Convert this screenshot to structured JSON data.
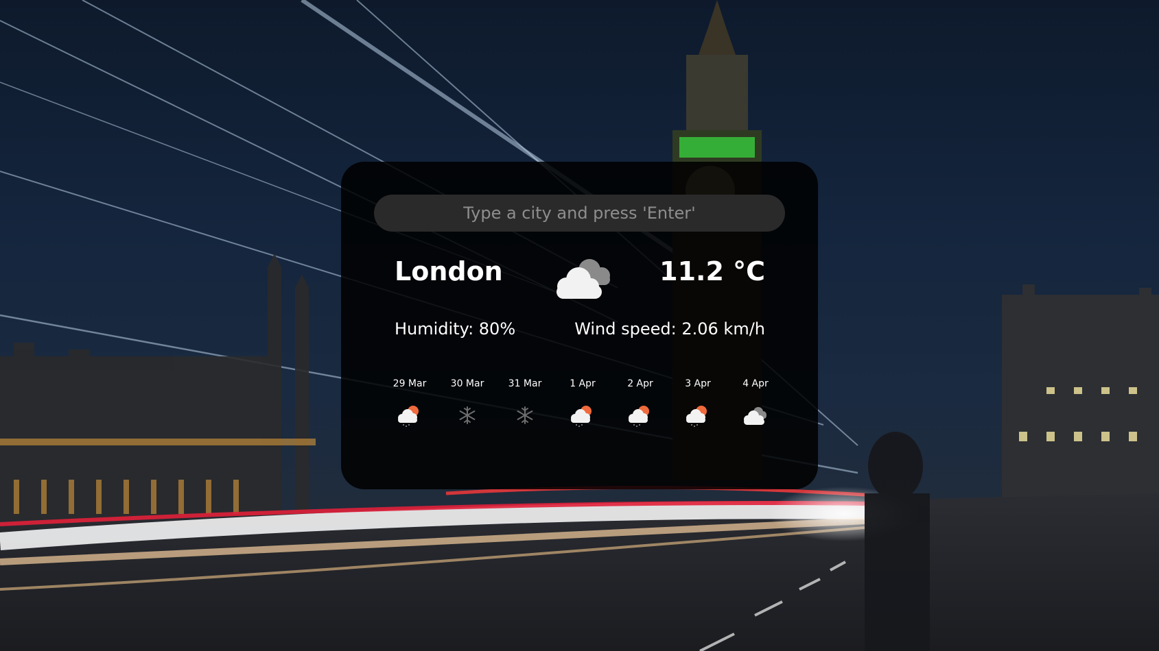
{
  "search": {
    "placeholder": "Type a city and press 'Enter'",
    "value": ""
  },
  "current": {
    "city": "London",
    "icon": "cloudy-icon",
    "temperature": "11.2 °C",
    "humidity": "Humidity: 80%",
    "wind": "Wind speed: 2.06 km/h"
  },
  "forecast": [
    {
      "date": "29 Mar",
      "icon": "sun-cloud-rain-icon"
    },
    {
      "date": "30 Mar",
      "icon": "snowflake-icon"
    },
    {
      "date": "31 Mar",
      "icon": "snowflake-icon"
    },
    {
      "date": "1 Apr",
      "icon": "sun-cloud-rain-icon"
    },
    {
      "date": "2 Apr",
      "icon": "sun-cloud-rain-icon"
    },
    {
      "date": "3 Apr",
      "icon": "sun-cloud-rain-icon"
    },
    {
      "date": "4 Apr",
      "icon": "cloudy-icon"
    }
  ],
  "colors": {
    "card_background": "#000000",
    "search_background": "#2a2a2a",
    "text": "#ffffff",
    "placeholder": "#8e8e8e",
    "sun": "#ef6a3c"
  }
}
